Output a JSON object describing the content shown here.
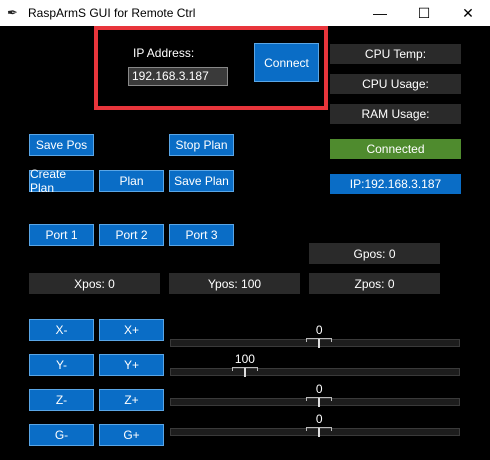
{
  "window": {
    "title": "RaspArmS GUI for Remote Ctrl",
    "min_glyph": "—",
    "max_glyph": "☐",
    "close_glyph": "✕"
  },
  "connection": {
    "ip_label": "IP Address:",
    "ip_value": "192.168.3.187",
    "connect_label": "Connect"
  },
  "status": {
    "cpu_temp": "CPU Temp:",
    "cpu_usage": "CPU Usage:",
    "ram_usage": "RAM Usage:",
    "connected": "Connected",
    "ip_display": "IP:192.168.3.187",
    "connected_color": "#4f8b2e",
    "accent": "#0a6dc6"
  },
  "plan": {
    "save_pos": "Save Pos",
    "stop_plan": "Stop Plan",
    "create_plan": "Create Plan",
    "plan": "Plan",
    "save_plan": "Save Plan"
  },
  "ports": {
    "port1": "Port 1",
    "port2": "Port 2",
    "port3": "Port 3"
  },
  "positions": {
    "gpos": "Gpos: 0",
    "xpos": "Xpos: 0",
    "ypos": "Ypos: 100",
    "zpos": "Zpos: 0"
  },
  "jog": {
    "x_minus": "X-",
    "x_plus": "X+",
    "y_minus": "Y-",
    "y_plus": "Y+",
    "z_minus": "Z-",
    "z_plus": "Z+",
    "g_minus": "G-",
    "g_plus": "G+"
  },
  "sliders": [
    {
      "value": "0",
      "level": 0.515
    },
    {
      "value": "100",
      "level": 0.26
    },
    {
      "value": "0",
      "level": 0.515
    },
    {
      "value": "0",
      "level": 0.515
    }
  ]
}
